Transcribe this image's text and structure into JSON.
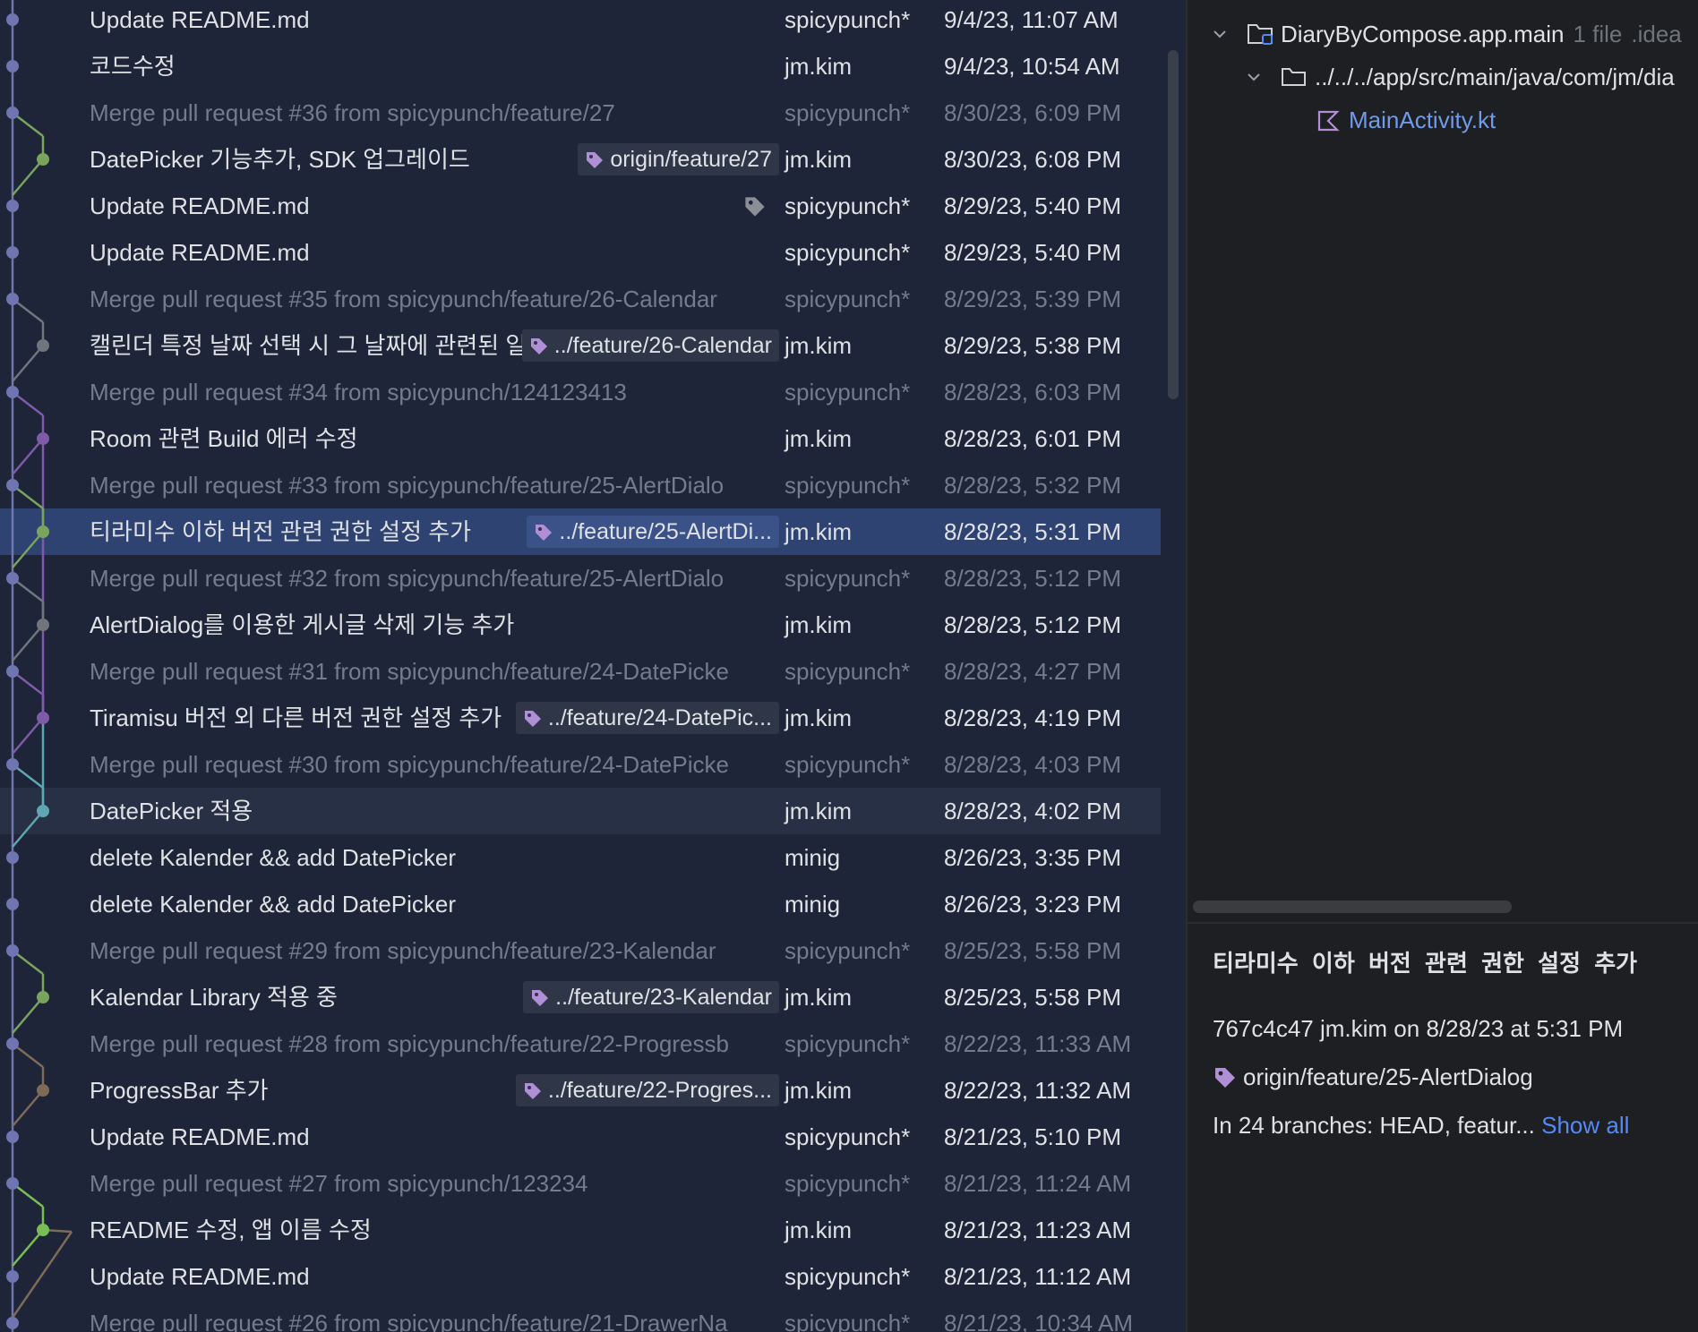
{
  "commits": [
    {
      "subject": "Update README.md",
      "author": "spicypunch*",
      "date": "9/4/23, 11:07 AM",
      "merge": false
    },
    {
      "subject": "코드수정",
      "author": "jm.kim",
      "date": "9/4/23, 10:54 AM",
      "merge": false
    },
    {
      "subject": "Merge pull request #36 from spicypunch/feature/27",
      "author": "spicypunch*",
      "date": "8/30/23, 6:09 PM",
      "merge": true
    },
    {
      "subject": "DatePicker 기능추가, SDK 업그레이드",
      "author": "jm.kim",
      "date": "8/30/23, 6:08 PM",
      "merge": false,
      "tag": "origin/feature/27"
    },
    {
      "subject": "Update README.md",
      "author": "spicypunch*",
      "date": "8/29/23, 5:40 PM",
      "merge": false,
      "tag_icon_only": true
    },
    {
      "subject": "Update README.md",
      "author": "spicypunch*",
      "date": "8/29/23, 5:40 PM",
      "merge": false
    },
    {
      "subject": "Merge pull request #35 from spicypunch/feature/26-Calendar",
      "author": "spicypunch*",
      "date": "8/29/23, 5:39 PM",
      "merge": true
    },
    {
      "subject": "캘린더 특정 날짜 선택 시 그 날짜에 관련된 일기",
      "author": "jm.kim",
      "date": "8/29/23, 5:38 PM",
      "merge": false,
      "tag": "../feature/26-Calendar"
    },
    {
      "subject": "Merge pull request #34 from spicypunch/124123413",
      "author": "spicypunch*",
      "date": "8/28/23, 6:03 PM",
      "merge": true
    },
    {
      "subject": "Room 관련 Build 에러 수정",
      "author": "jm.kim",
      "date": "8/28/23, 6:01 PM",
      "merge": false
    },
    {
      "subject": "Merge pull request #33 from spicypunch/feature/25-AlertDialo",
      "author": "spicypunch*",
      "date": "8/28/23, 5:32 PM",
      "merge": true
    },
    {
      "subject": "티라미수 이하 버전 관련 권한 설정 추가",
      "author": "jm.kim",
      "date": "8/28/23, 5:31 PM",
      "merge": false,
      "tag": "../feature/25-AlertDi...",
      "selected": true
    },
    {
      "subject": "Merge pull request #32 from spicypunch/feature/25-AlertDialo",
      "author": "spicypunch*",
      "date": "8/28/23, 5:12 PM",
      "merge": true
    },
    {
      "subject": "AlertDialog를 이용한 게시글 삭제 기능 추가",
      "author": "jm.kim",
      "date": "8/28/23, 5:12 PM",
      "merge": false
    },
    {
      "subject": "Merge pull request #31 from spicypunch/feature/24-DatePicke",
      "author": "spicypunch*",
      "date": "8/28/23, 4:27 PM",
      "merge": true
    },
    {
      "subject": "Tiramisu 버전 외 다른 버전 권한 설정 추가",
      "author": "jm.kim",
      "date": "8/28/23, 4:19 PM",
      "merge": false,
      "tag": "../feature/24-DatePic..."
    },
    {
      "subject": "Merge pull request #30 from spicypunch/feature/24-DatePicke",
      "author": "spicypunch*",
      "date": "8/28/23, 4:03 PM",
      "merge": true
    },
    {
      "subject": "DatePicker 적용",
      "author": "jm.kim",
      "date": "8/28/23, 4:02 PM",
      "merge": false,
      "hover": true
    },
    {
      "subject": "delete Kalender && add DatePicker",
      "author": "minig",
      "date": "8/26/23, 3:35 PM",
      "merge": false
    },
    {
      "subject": "delete Kalender && add DatePicker",
      "author": "minig",
      "date": "8/26/23, 3:23 PM",
      "merge": false
    },
    {
      "subject": "Merge pull request #29 from spicypunch/feature/23-Kalendar",
      "author": "spicypunch*",
      "date": "8/25/23, 5:58 PM",
      "merge": true
    },
    {
      "subject": "Kalendar Library 적용 중",
      "author": "jm.kim",
      "date": "8/25/23, 5:58 PM",
      "merge": false,
      "tag": "../feature/23-Kalendar"
    },
    {
      "subject": "Merge pull request #28 from spicypunch/feature/22-Progressb",
      "author": "spicypunch*",
      "date": "8/22/23, 11:33 AM",
      "merge": true
    },
    {
      "subject": "ProgressBar 추가",
      "author": "jm.kim",
      "date": "8/22/23, 11:32 AM",
      "merge": false,
      "tag": "../feature/22-Progres..."
    },
    {
      "subject": "Update README.md",
      "author": "spicypunch*",
      "date": "8/21/23, 5:10 PM",
      "merge": false
    },
    {
      "subject": "Merge pull request #27 from spicypunch/123234",
      "author": "spicypunch*",
      "date": "8/21/23, 11:24 AM",
      "merge": true
    },
    {
      "subject": "README 수정, 앱 이름 수정",
      "author": "jm.kim",
      "date": "8/21/23, 11:23 AM",
      "merge": false
    },
    {
      "subject": "Update README.md",
      "author": "spicypunch*",
      "date": "8/21/23, 11:12 AM",
      "merge": false
    },
    {
      "subject": "Merge pull request #26 from spicypunch/feature/21-DrawerNa",
      "author": "spicypunch*",
      "date": "8/21/23, 10:34 AM",
      "merge": true
    }
  ],
  "changes_tree": {
    "module": {
      "name": "DiaryByCompose.app.main",
      "count": "1 file",
      "path_hint": ".idea"
    },
    "folder": {
      "name": "../../../app/src/main/java/com/jm/dia"
    },
    "file": {
      "name": "MainActivity.kt"
    }
  },
  "details": {
    "title": "티라미수 이하 버전 관련 권한 설정 추가",
    "meta": "767c4c47 jm.kim on 8/28/23 at 5:31 PM",
    "tag": "origin/feature/25-AlertDialog",
    "branches": "In 24 branches: HEAD, featur...",
    "show_all": "Show all"
  },
  "colors": {
    "lane_main": "#6f75b0",
    "lane_green": "#7aa35e",
    "lane_purple": "#7e5aa8",
    "lane_teal": "#5fa6b2",
    "lane_gray": "#70757e",
    "lane_brown": "#7d6b58",
    "lane_lime": "#7bbd55",
    "tag_purple": "#b08fd7",
    "link_blue": "#548af7"
  }
}
